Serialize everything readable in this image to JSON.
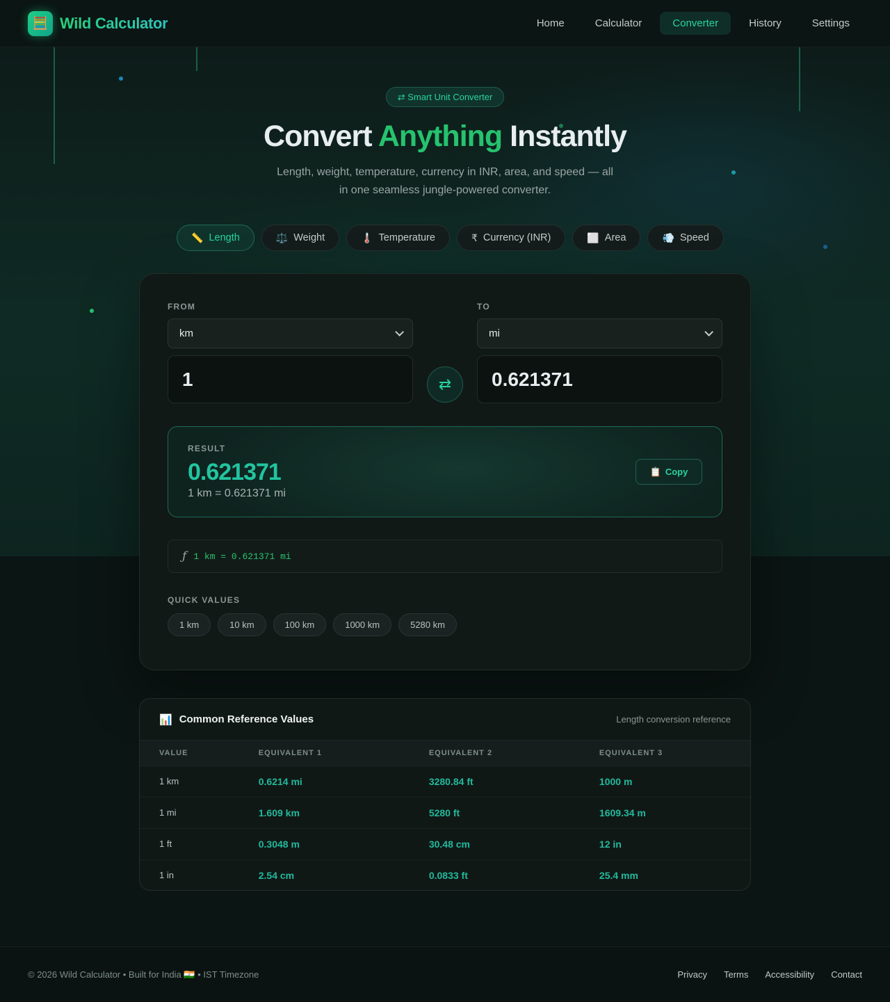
{
  "brand": {
    "name": "Wild Calculator",
    "logo_icon": "abacus-icon"
  },
  "nav": {
    "items": [
      {
        "label": "Home",
        "active": false
      },
      {
        "label": "Calculator",
        "active": false
      },
      {
        "label": "Converter",
        "active": true
      },
      {
        "label": "History",
        "active": false
      },
      {
        "label": "Settings",
        "active": false
      }
    ]
  },
  "hero": {
    "badge": "⇄ Smart Unit Converter",
    "headline_pre": "Convert ",
    "headline_accent": "Anything",
    "headline_post": " Instantly",
    "subtitle": "Length, weight, temperature, currency in INR, area, and speed — all in one seamless jungle-powered converter."
  },
  "tabs": [
    {
      "icon": "📏",
      "label": "Length",
      "active": true
    },
    {
      "icon": "⚖️",
      "label": "Weight",
      "active": false
    },
    {
      "icon": "🌡️",
      "label": "Temperature",
      "active": false
    },
    {
      "icon": "₹",
      "label": "Currency (INR)",
      "active": false
    },
    {
      "icon": "⬜",
      "label": "Area",
      "active": false
    },
    {
      "icon": "💨",
      "label": "Speed",
      "active": false
    }
  ],
  "converter": {
    "from_label": "FROM",
    "to_label": "TO",
    "from_unit": "km",
    "to_unit": "mi",
    "from_value": "1",
    "to_value": "0.621371",
    "swap_icon": "⇄"
  },
  "result": {
    "label": "RESULT",
    "value": "0.621371",
    "equation": "1 km = 0.621371 mi",
    "copy_label": "Copy",
    "copy_icon": "📋"
  },
  "formula": {
    "icon": "ƒ",
    "text": "1 km = 0.621371 mi"
  },
  "quick": {
    "label": "QUICK VALUES",
    "values": [
      "1 km",
      "10 km",
      "100 km",
      "1000 km",
      "5280 km"
    ]
  },
  "reference": {
    "icon": "📊",
    "title": "Common Reference Values",
    "subtitle": "Length conversion reference",
    "headers": [
      "VALUE",
      "EQUIVALENT 1",
      "EQUIVALENT 2",
      "EQUIVALENT 3"
    ],
    "rows": [
      [
        "1 km",
        "0.6214 mi",
        "3280.84 ft",
        "1000 m"
      ],
      [
        "1 mi",
        "1.609 km",
        "5280 ft",
        "1609.34 m"
      ],
      [
        "1 ft",
        "0.3048 m",
        "30.48 cm",
        "12 in"
      ],
      [
        "1 in",
        "2.54 cm",
        "0.0833 ft",
        "25.4 mm"
      ]
    ]
  },
  "footer": {
    "copyright": "© 2026 Wild Calculator • Built for India 🇮🇳 • IST Timezone",
    "links": [
      "Privacy",
      "Terms",
      "Accessibility",
      "Contact"
    ]
  },
  "colors": {
    "accent": "#26c26e",
    "teal": "#22c4a0",
    "background": "#0b1513"
  }
}
